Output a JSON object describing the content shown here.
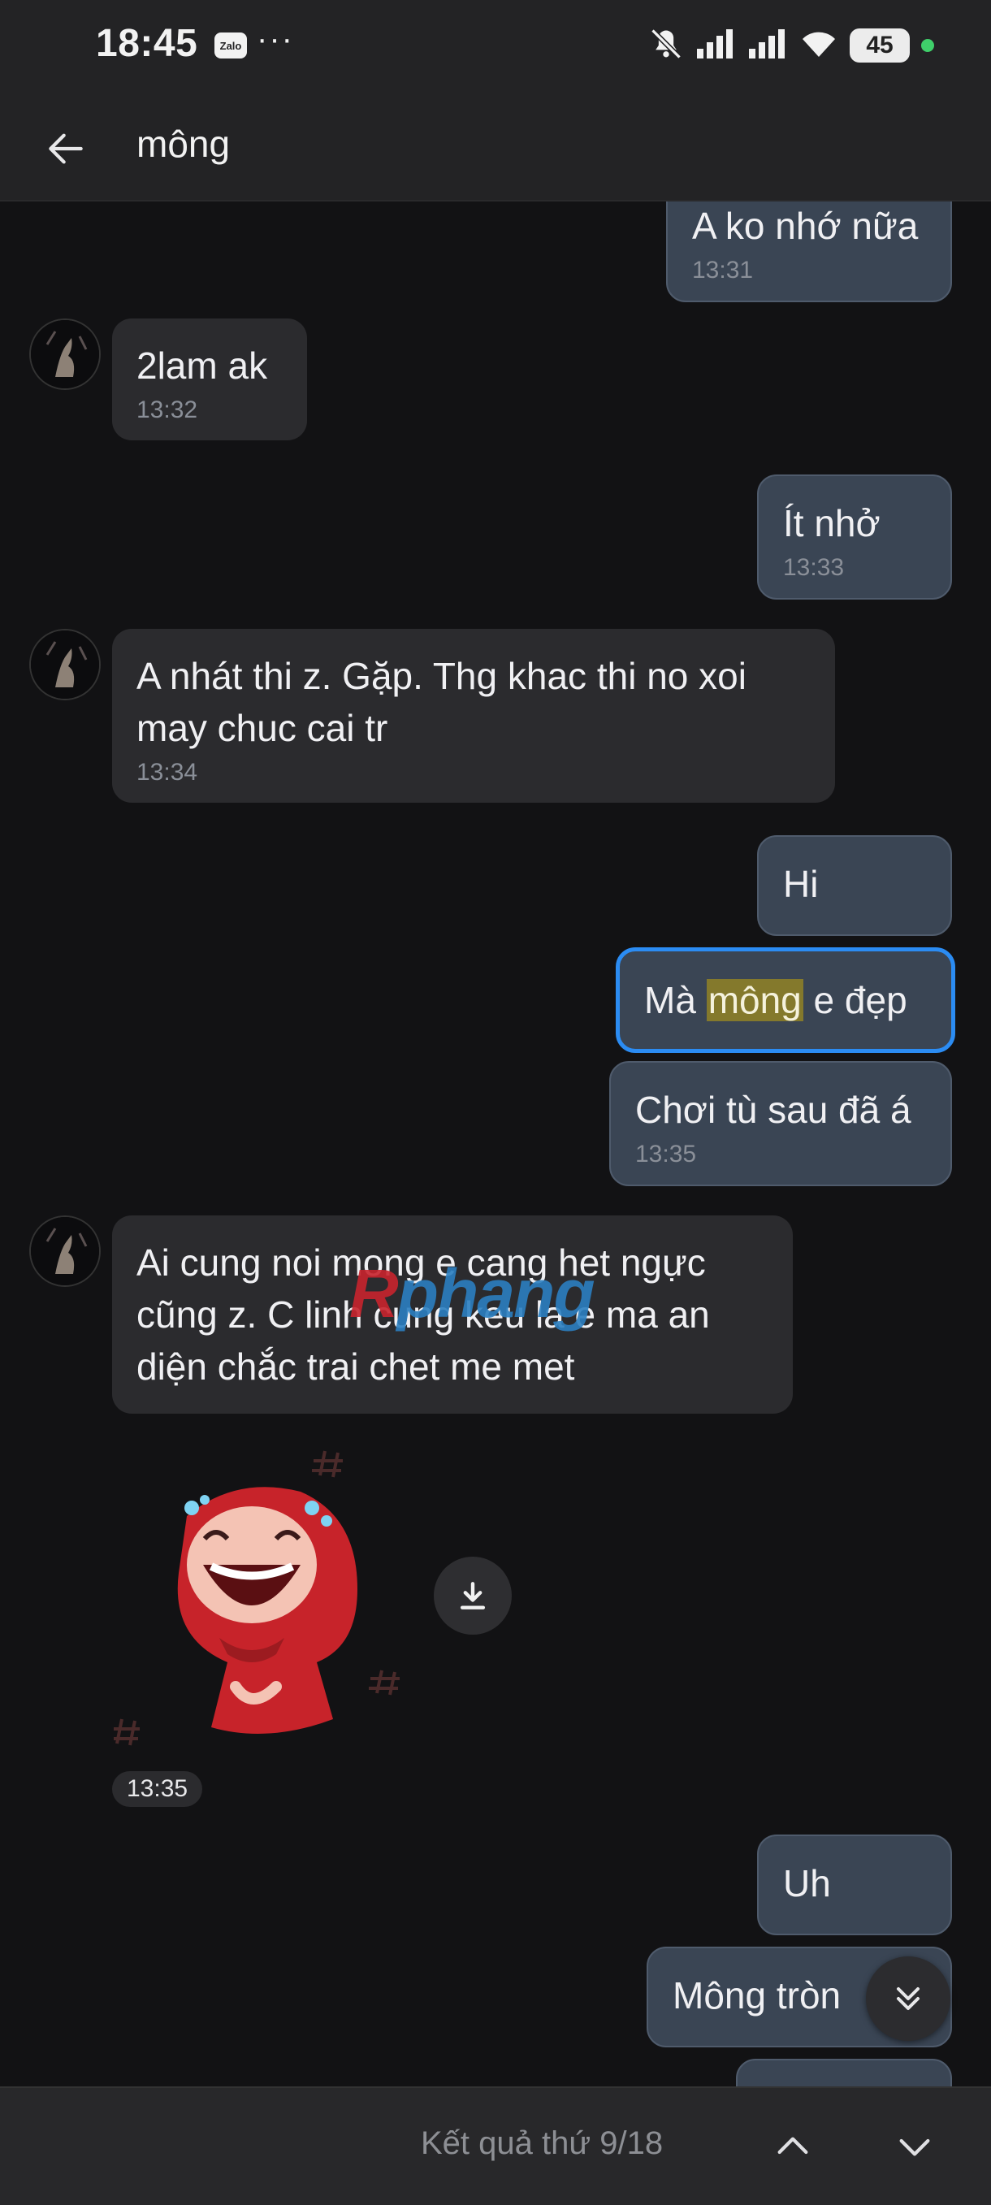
{
  "status_bar": {
    "time": "18:45",
    "app_badge": "Zalo",
    "more": "···",
    "battery": "45"
  },
  "header": {
    "title": "mông"
  },
  "messages": [
    {
      "text": "A ko nhớ nữa",
      "time": "13:31"
    },
    {
      "text": "2lam ak",
      "time": "13:32"
    },
    {
      "text": "Ít nhở",
      "time": "13:33"
    },
    {
      "text": "A nhát thi z. Gặp. Thg khac thi no xoi may chuc cai tr",
      "time": "13:34"
    },
    {
      "text": "Hi"
    },
    {
      "pre": "Mà ",
      "highlight": "mông",
      "post": " e đẹp"
    },
    {
      "text": "Chơi tù sau đã á",
      "time": "13:35"
    },
    {
      "text": "Ai cung noi mong e cang het ngực cũng z. C linh cung keu la e ma an diện chắc trai chet me met"
    },
    {
      "text": "Uh"
    },
    {
      "text": "Mông tròn"
    }
  ],
  "sticker": {
    "time": "13:35"
  },
  "watermark": {
    "first": "R",
    "rest": "phang"
  },
  "search_nav": {
    "result_text": "Kết quả thứ 9/18"
  }
}
